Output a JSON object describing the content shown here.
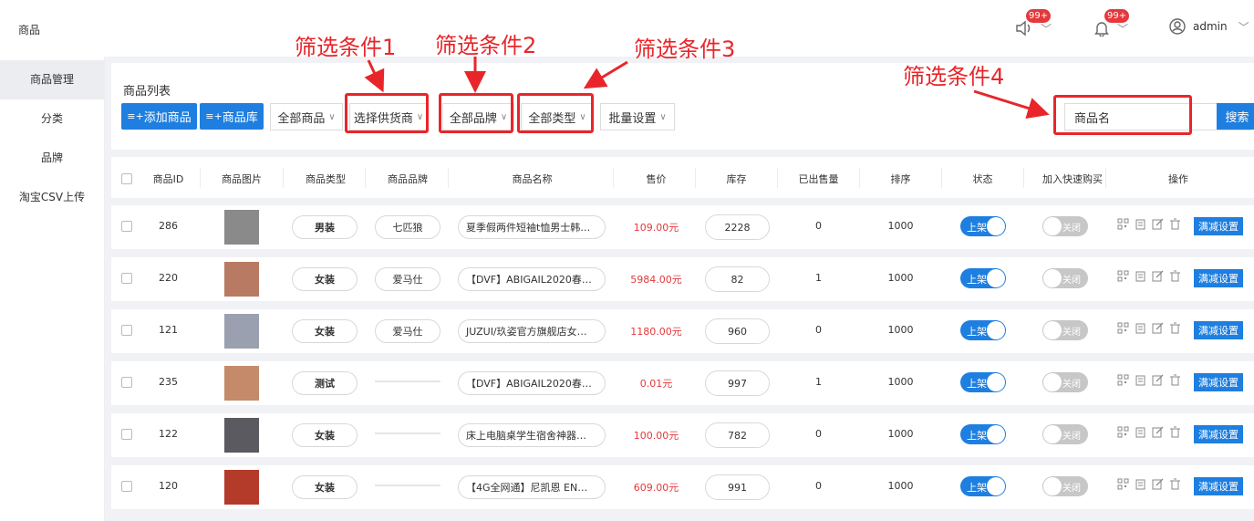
{
  "header": {
    "app_title": "商品",
    "badge1": "99+",
    "badge2": "99+",
    "user": "admin"
  },
  "sidebar": {
    "items": [
      {
        "label": "商品管理"
      },
      {
        "label": "分类"
      },
      {
        "label": "品牌"
      },
      {
        "label": "淘宝CSV上传"
      }
    ]
  },
  "panel": {
    "title": "商品列表",
    "add_btn": "添加商品",
    "lib_btn": "商品库",
    "all_goods": "全部商品",
    "supplier": "选择供货商",
    "brand": "全部品牌",
    "type": "全部类型",
    "batch": "批量设置",
    "search_placeholder": "商品名",
    "search_btn": "搜索"
  },
  "annotations": {
    "a1": "筛选条件1",
    "a2": "筛选条件2",
    "a3": "筛选条件3",
    "a4": "筛选条件4"
  },
  "table": {
    "headers": [
      "商品ID",
      "商品图片",
      "商品类型",
      "商品品牌",
      "商品名称",
      "售价",
      "库存",
      "已出售量",
      "排序",
      "状态",
      "加入快速购买",
      "操作"
    ],
    "rows": [
      {
        "id": "286",
        "type": "男装",
        "brand": "七匹狼",
        "name": "夏季假两件短袖t恤男士韩…",
        "price": "109.00元",
        "stock": "2228",
        "sold": "0",
        "sort": "1000",
        "status": "上架",
        "quick": "关闭",
        "action": "满减设置",
        "img_color": "#8a8a8a"
      },
      {
        "id": "220",
        "type": "女装",
        "brand": "爱马仕",
        "name": "【DVF】ABIGAIL2020春…",
        "price": "5984.00元",
        "stock": "82",
        "sold": "1",
        "sort": "1000",
        "status": "上架",
        "quick": "关闭",
        "action": "满减设置",
        "img_color": "#b87a63"
      },
      {
        "id": "121",
        "type": "女装",
        "brand": "爱马仕",
        "name": "JUZUI/玖姿官方旗舰店女…",
        "price": "1180.00元",
        "stock": "960",
        "sold": "0",
        "sort": "1000",
        "status": "上架",
        "quick": "关闭",
        "action": "满减设置",
        "img_color": "#9aa0b0"
      },
      {
        "id": "235",
        "type": "测试",
        "brand": "",
        "name": "【DVF】ABIGAIL2020春…",
        "price": "0.01元",
        "stock": "997",
        "sold": "1",
        "sort": "1000",
        "status": "上架",
        "quick": "关闭",
        "action": "满减设置",
        "img_color": "#c48a6a"
      },
      {
        "id": "122",
        "type": "女装",
        "brand": "",
        "name": "床上电脑桌学生宿舍神器…",
        "price": "100.00元",
        "stock": "782",
        "sold": "0",
        "sort": "1000",
        "status": "上架",
        "quick": "关闭",
        "action": "满减设置",
        "img_color": "#5a5a60"
      },
      {
        "id": "120",
        "type": "女装",
        "brand": "",
        "name": "【4G全网通】尼凯恩 EN…",
        "price": "609.00元",
        "stock": "991",
        "sold": "0",
        "sort": "1000",
        "status": "上架",
        "quick": "关闭",
        "action": "满减设置",
        "img_color": "#b43a2a"
      }
    ]
  },
  "colors": {
    "accent": "#1e7fe0",
    "annotation": "#e8262a",
    "price": "#e4393c"
  }
}
